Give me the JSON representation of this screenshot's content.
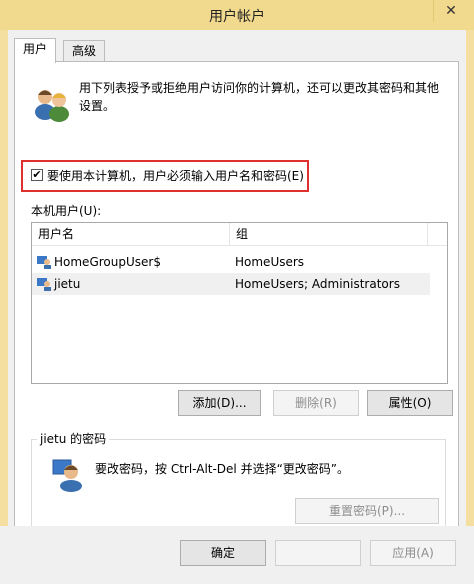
{
  "window": {
    "title": "用户帐户",
    "close_symbol": "✕"
  },
  "tabs": [
    {
      "label": "用户",
      "active": true
    },
    {
      "label": "高级",
      "active": false
    }
  ],
  "intro": {
    "icon": "users-icon",
    "text": "用下列表授予或拒绝用户访问你的计算机，还可以更改其密码和其他设置。"
  },
  "require_password": {
    "checked": true,
    "check_symbol": "✔",
    "label": "要使用本计算机，用户必须输入用户名和密码(E)"
  },
  "local_users": {
    "label": "本机用户(U):",
    "columns": [
      "用户名",
      "组"
    ],
    "rows": [
      {
        "name": "HomeGroupUser$",
        "group": "HomeUsers",
        "icon": "user-icon"
      },
      {
        "name": "jietu",
        "group": "HomeUsers; Administrators",
        "icon": "user-icon",
        "selected": true
      }
    ]
  },
  "buttons": {
    "add": "添加(D)...",
    "delete": "删除(R)",
    "properties": "属性(O)"
  },
  "password_group": {
    "title": "jietu 的密码",
    "icon": "user-key-icon",
    "text": "要改密码，按 Ctrl-Alt-Del 并选择“更改密码”。",
    "reset_button": "重置密码(P)..."
  },
  "dialog_buttons": {
    "ok": "确定",
    "cancel": "",
    "apply": "应用(A)"
  },
  "colors": {
    "title_bar": "#f1d98e",
    "highlight_box": "#e0302e",
    "selected_row": "#f0f0f0"
  }
}
